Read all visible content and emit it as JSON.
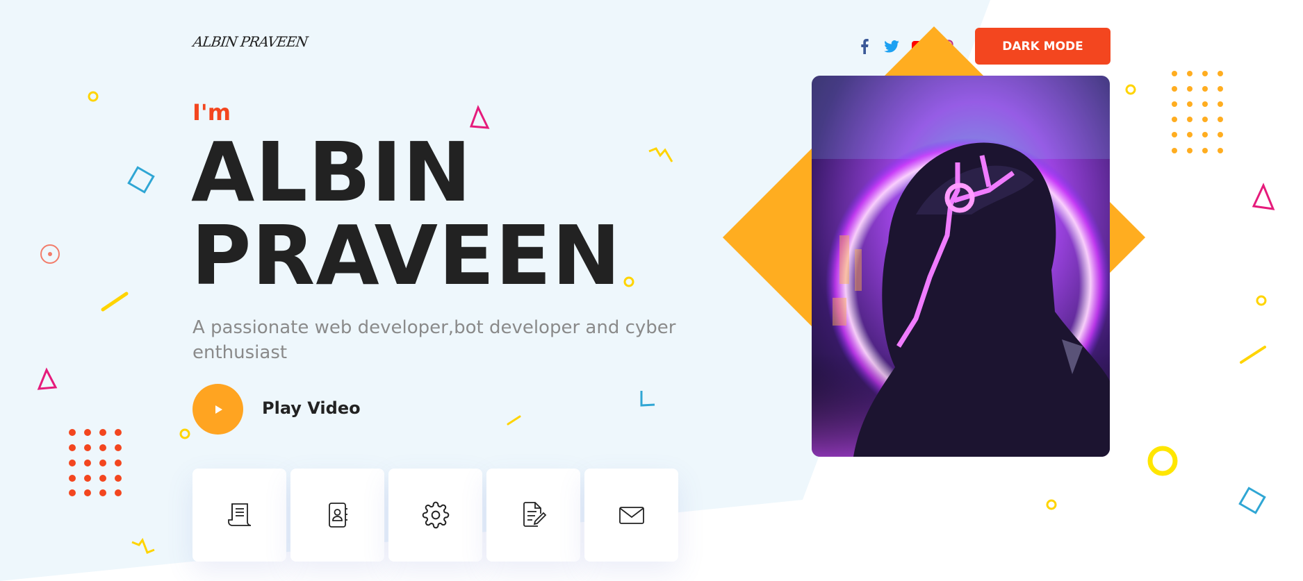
{
  "header": {
    "logo_text": "ALBIN PRAVEEN",
    "social": [
      {
        "name": "facebook-icon",
        "color": "#3b5998"
      },
      {
        "name": "twitter-icon",
        "color": "#1da1f2"
      },
      {
        "name": "youtube-icon",
        "color": "#ff0000"
      },
      {
        "name": "instagram-icon",
        "color": "#c13584"
      }
    ],
    "dark_mode_label": "DARK MODE"
  },
  "hero": {
    "intro": "I'm",
    "first_name": "ALBIN",
    "last_name": "PRAVEEN",
    "tagline": "A passionate web developer,bot developer and cyber enthusiast",
    "play_label": "Play Video"
  },
  "tiles": [
    {
      "icon": "resume-scroll-icon"
    },
    {
      "icon": "contact-book-icon"
    },
    {
      "icon": "gear-icon"
    },
    {
      "icon": "document-edit-icon"
    },
    {
      "icon": "mail-icon"
    }
  ],
  "colors": {
    "accent_red": "#f3461f",
    "accent_orange": "#ffa421",
    "text_dark": "#222222",
    "text_muted": "#8a8a8a",
    "bg_tint": "#eef7fc"
  }
}
